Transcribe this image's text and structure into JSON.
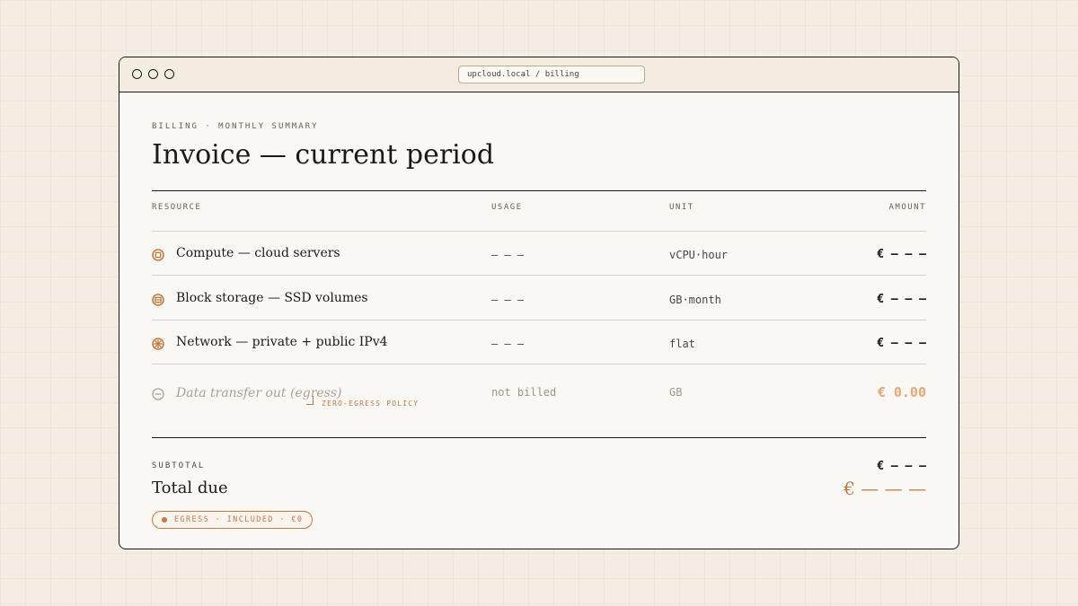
{
  "browser": {
    "url": "upcloud.local / billing"
  },
  "page": {
    "eyebrow": "BILLING · MONTHLY SUMMARY",
    "title": "Invoice — current period"
  },
  "table": {
    "headers": {
      "resource": "RESOURCE",
      "usage": "USAGE",
      "unit": "UNIT",
      "amount": "AMOUNT"
    },
    "rows": [
      {
        "icon": "cpu-icon",
        "resource": "Compute — cloud servers",
        "usage": "– – –",
        "unit": "vCPU·hour",
        "amount": "€ – – –"
      },
      {
        "icon": "storage-icon",
        "resource": "Block storage — SSD volumes",
        "usage": "– – –",
        "unit": "GB·month",
        "amount": "€ – – –"
      },
      {
        "icon": "network-icon",
        "resource": "Network — private + public IPv4",
        "usage": "– – –",
        "unit": "flat",
        "amount": "€ – – –"
      },
      {
        "icon": "no-charge-icon",
        "resource": "Data transfer out (egress)",
        "usage": "not billed",
        "unit": "GB",
        "amount": "€ 0.00",
        "note": "ZERO-EGRESS POLICY"
      }
    ]
  },
  "summary": {
    "subtotal_label": "SUBTOTAL",
    "subtotal_value": "€ – – –",
    "total_label": "Total due",
    "total_value": "€ — — —",
    "badge": "EGRESS · INCLUDED · €0"
  },
  "colors": {
    "accent": "#c07a45",
    "ink": "#1c1a17",
    "paper": "#faf8f4",
    "background": "#f4ede3"
  }
}
